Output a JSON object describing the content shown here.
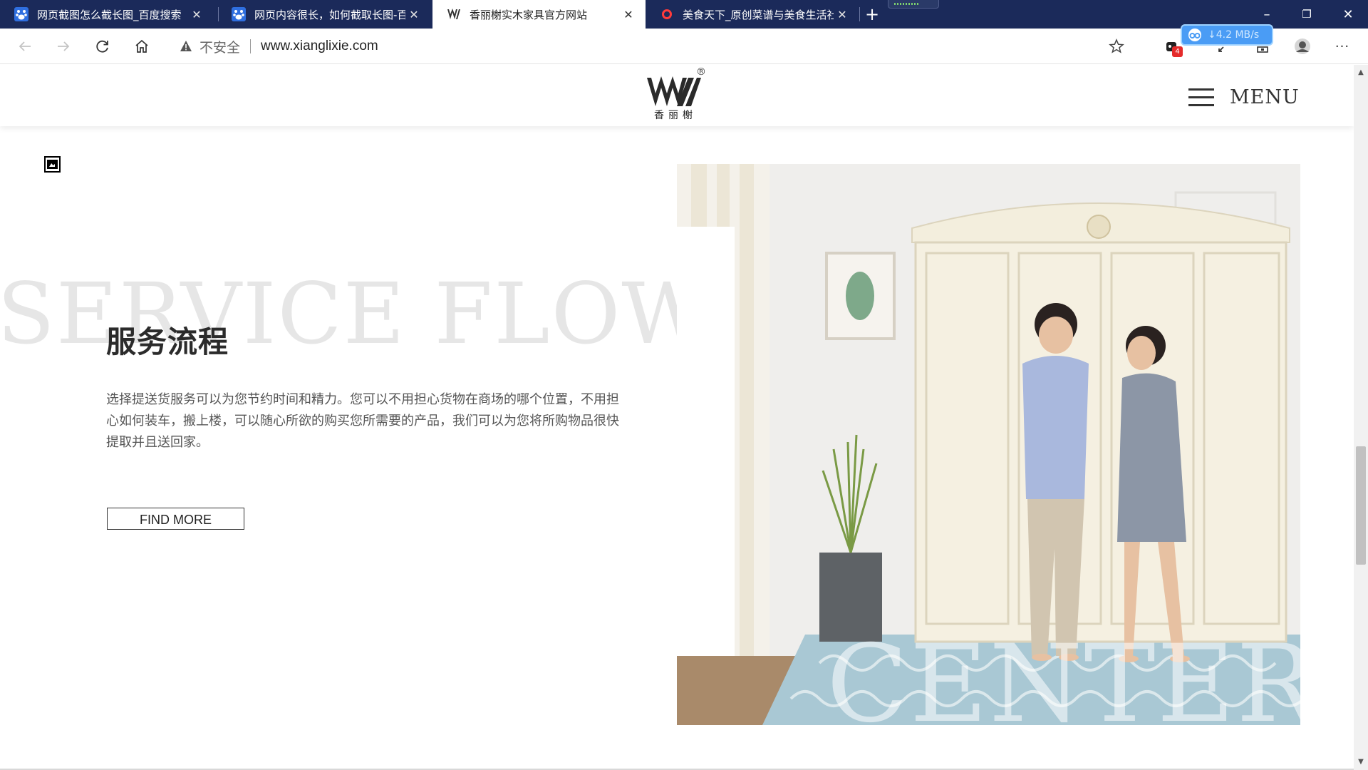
{
  "browser": {
    "tabs": [
      {
        "title": "网页截图怎么截长图_百度搜索",
        "favicon": "baidu-paw-icon",
        "active": false
      },
      {
        "title": "网页内容很长，如何截取长图-百",
        "favicon": "baidu-paw-icon",
        "active": false
      },
      {
        "title": "香丽榭实木家具官方网站",
        "favicon": "xianglixie-logo-icon",
        "active": true
      },
      {
        "title": "美食天下_原创菜谱与美食生活社",
        "favicon": "meishi-ring-icon",
        "active": false
      }
    ],
    "new_tab_symbol": "+",
    "window_controls": {
      "minimize": "–",
      "restore": "❐",
      "close": "✕"
    },
    "address": {
      "security_label": "不安全",
      "url": "www.xianglixie.com"
    },
    "extension_badge": "4",
    "download_speed": "↓4.2 MB/s",
    "more_symbol": "···"
  },
  "site": {
    "menu_label": "MENU",
    "logo_registered": "®",
    "logo_chinese": "香丽榭",
    "background_word": "SERVICE FLOW",
    "section_title": "服务流程",
    "section_description": "选择提送货服务可以为您节约时间和精力。您可以不用担心货物在商场的哪个位置，不用担心如何装车，搬上楼，可以随心所欲的购买您所需要的产品，我们可以为您将所购物品很快提取并且送回家。",
    "button_label": "FIND MORE",
    "photo_overlay_word": "CENTER"
  },
  "colors": {
    "tab_strip": "#1b2a5a",
    "download_pill": "#4a9cf5",
    "watermark_text": "#e6e6e6"
  }
}
